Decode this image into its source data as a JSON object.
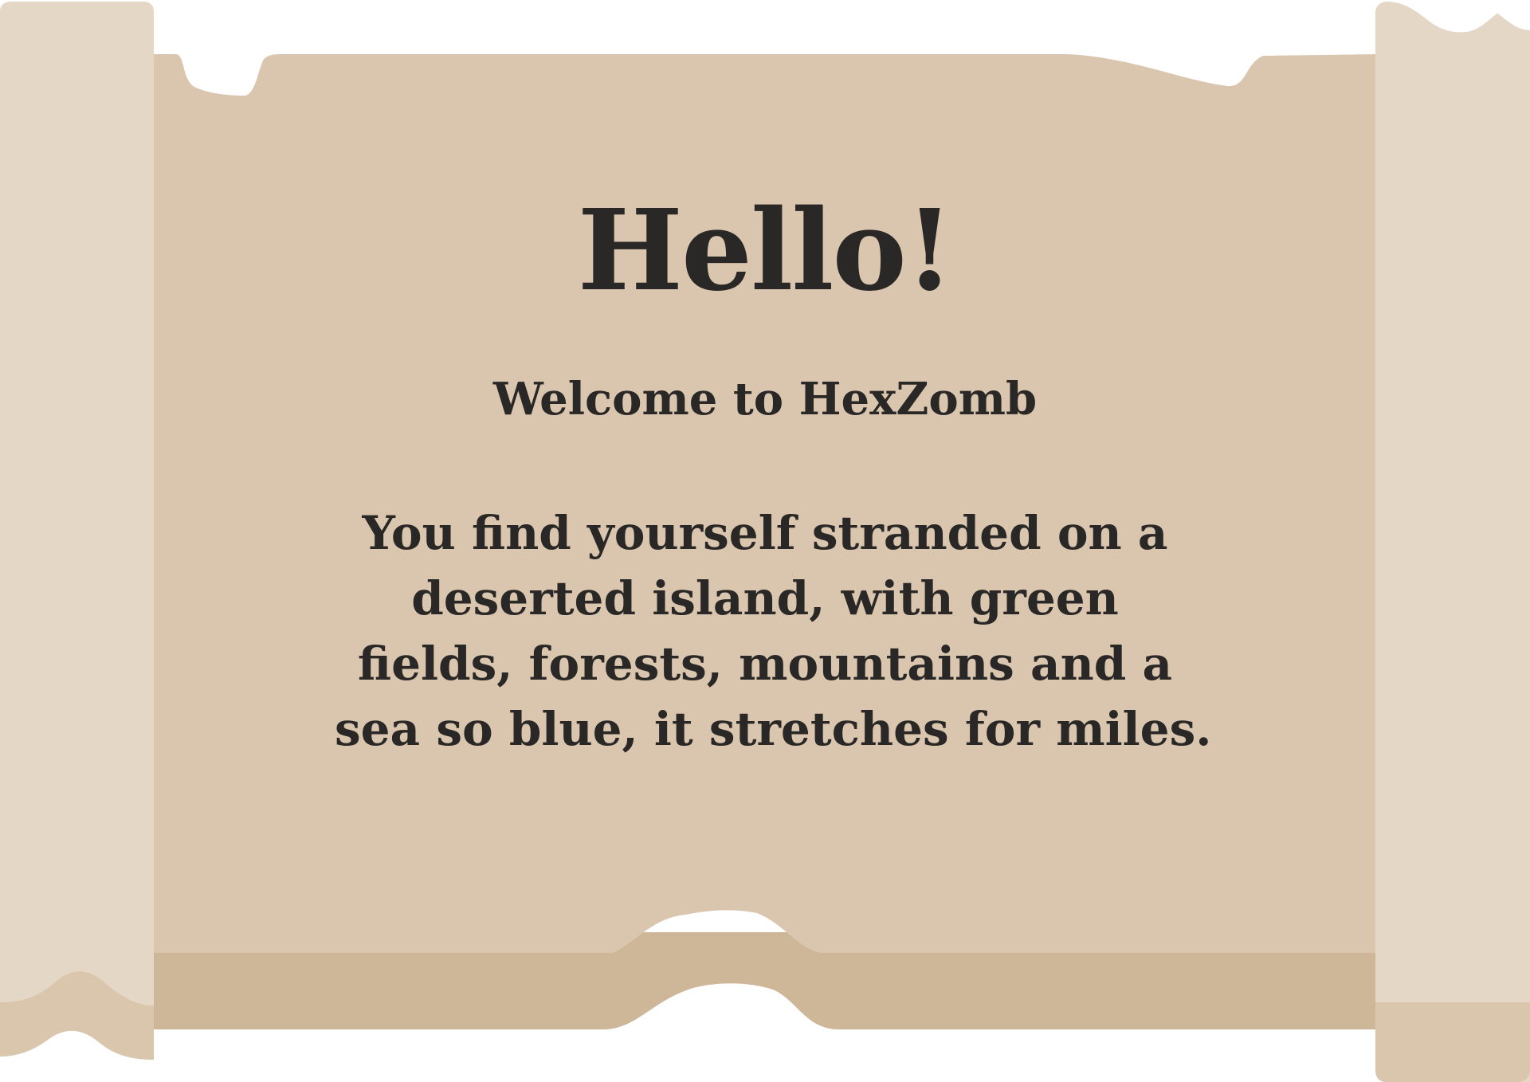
{
  "scroll": {
    "title": "Hello!",
    "subtitle": "Welcome to HexZomb",
    "body_lines": [
      "You find yourself stranded on a",
      "deserted island, with green",
      "fields, forests, mountains and a",
      "sea so blue, it stretches for miles."
    ]
  },
  "colors": {
    "parchment": "#dac6ae",
    "parchment_shadow": "#ceb699",
    "roller_light": "#e5d7c6",
    "roller_shadow": "#d9c6ad",
    "text": "#2a2826"
  }
}
